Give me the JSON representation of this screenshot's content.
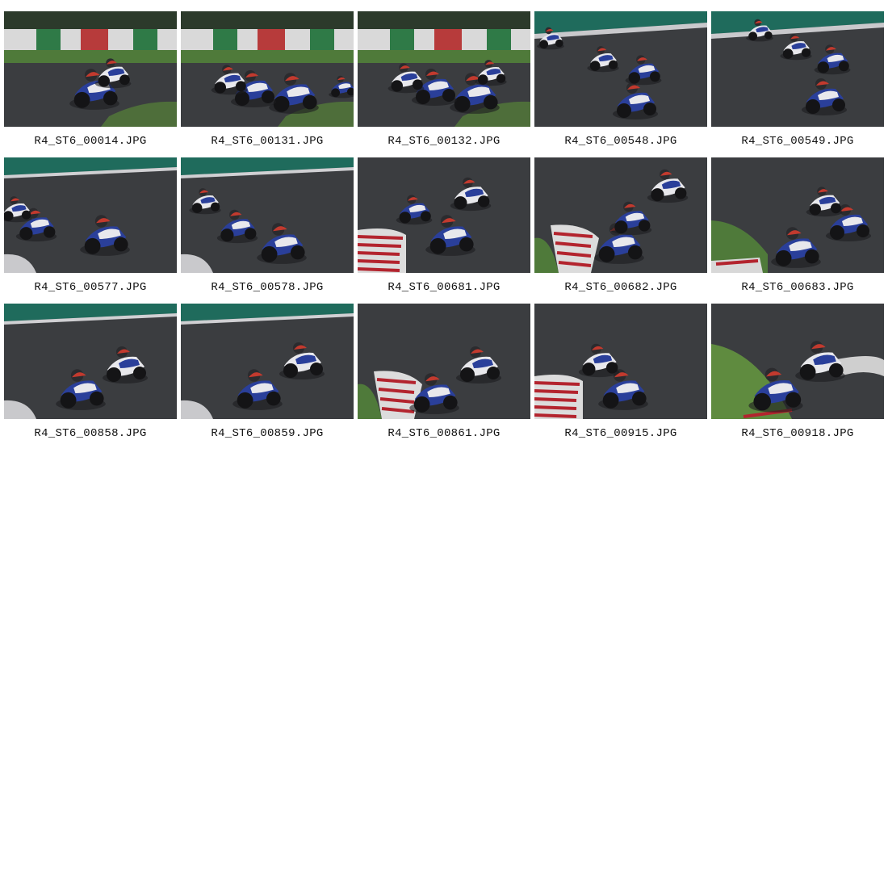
{
  "gallery": {
    "items": [
      {
        "filename": "R4_ST6_00014.JPG",
        "scene": "trees"
      },
      {
        "filename": "R4_ST6_00131.JPG",
        "scene": "trees"
      },
      {
        "filename": "R4_ST6_00132.JPG",
        "scene": "trees"
      },
      {
        "filename": "R4_ST6_00548.JPG",
        "scene": "track"
      },
      {
        "filename": "R4_ST6_00549.JPG",
        "scene": "track"
      },
      {
        "filename": "R4_ST6_00577.JPG",
        "scene": "wall"
      },
      {
        "filename": "R4_ST6_00578.JPG",
        "scene": "wall"
      },
      {
        "filename": "R4_ST6_00681.JPG",
        "scene": "kerb"
      },
      {
        "filename": "R4_ST6_00682.JPG",
        "scene": "kerb-grass"
      },
      {
        "filename": "R4_ST6_00683.JPG",
        "scene": "grass"
      },
      {
        "filename": "R4_ST6_00858.JPG",
        "scene": "wall"
      },
      {
        "filename": "R4_ST6_00859.JPG",
        "scene": "wall"
      },
      {
        "filename": "R4_ST6_00861.JPG",
        "scene": "kerb-grass"
      },
      {
        "filename": "R4_ST6_00915.JPG",
        "scene": "kerb"
      },
      {
        "filename": "R4_ST6_00918.JPG",
        "scene": "grass-bright"
      }
    ]
  },
  "colors": {
    "asphalt": "#3b3d40",
    "grass": "#4f7a3a",
    "wall_green": "#1f6b5c",
    "kerb_red": "#b3242e",
    "bike_blue": "#2a3f9a",
    "bike_white": "#e8e8ec"
  }
}
